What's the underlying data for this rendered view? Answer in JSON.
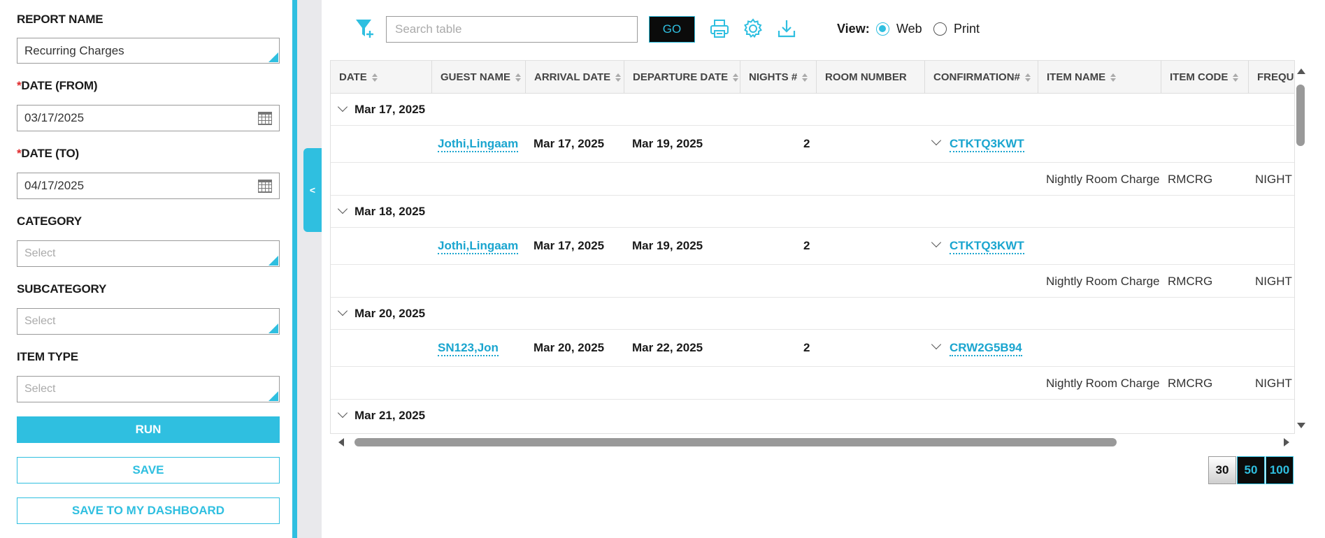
{
  "filters": {
    "report_name_label": "REPORT NAME",
    "report_name_value": "Recurring Charges",
    "required_mark": "*",
    "date_from_label": "DATE (FROM)",
    "date_from_value": "03/17/2025",
    "date_to_label": "DATE (TO)",
    "date_to_value": "04/17/2025",
    "category_label": "CATEGORY",
    "category_placeholder": "Select",
    "subcategory_label": "SUBCATEGORY",
    "subcategory_placeholder": "Select",
    "item_type_label": "ITEM TYPE",
    "item_type_placeholder": "Select",
    "run_label": "RUN",
    "save_label": "SAVE",
    "save_dashboard_label": "SAVE TO MY DASHBOARD"
  },
  "collapse_glyph": "<",
  "toolbar": {
    "search_placeholder": "Search table",
    "go_label": "GO",
    "view_label": "View:",
    "view_options": [
      {
        "label": "Web",
        "selected": true
      },
      {
        "label": "Print",
        "selected": false
      }
    ],
    "icons": [
      "filter-add-icon",
      "print-icon",
      "gear-icon",
      "download-icon"
    ]
  },
  "table": {
    "columns": [
      "DATE",
      "GUEST NAME",
      "ARRIVAL DATE",
      "DEPARTURE DATE",
      "NIGHTS #",
      "ROOM NUMBER",
      "CONFIRMATION#",
      "ITEM NAME",
      "ITEM CODE",
      "FREQUI"
    ],
    "groups": [
      {
        "date": "Mar 17, 2025",
        "guest": "Jothi,Lingaam",
        "arrival": "Mar 17, 2025",
        "departure": "Mar 19, 2025",
        "nights": "2",
        "room": "",
        "confirmation": "CTKTQ3KWT",
        "item_name": "Nightly Room Charge",
        "item_code": "RMCRG",
        "frequency": "NIGHT"
      },
      {
        "date": "Mar 18, 2025",
        "guest": "Jothi,Lingaam",
        "arrival": "Mar 17, 2025",
        "departure": "Mar 19, 2025",
        "nights": "2",
        "room": "",
        "confirmation": "CTKTQ3KWT",
        "item_name": "Nightly Room Charge",
        "item_code": "RMCRG",
        "frequency": "NIGHT"
      },
      {
        "date": "Mar 20, 2025",
        "guest": "SN123,Jon",
        "arrival": "Mar 20, 2025",
        "departure": "Mar 22, 2025",
        "nights": "2",
        "room": "",
        "confirmation": "CRW2G5B94",
        "item_name": "Nightly Room Charge",
        "item_code": "RMCRG",
        "frequency": "NIGHT"
      }
    ],
    "last_group_date": "Mar 21, 2025"
  },
  "pager": {
    "sizes": [
      "30",
      "50",
      "100"
    ],
    "selected": "30"
  },
  "colors": {
    "accent": "#2fbfe0",
    "link": "#1aa5cf",
    "required": "#e0292b"
  }
}
